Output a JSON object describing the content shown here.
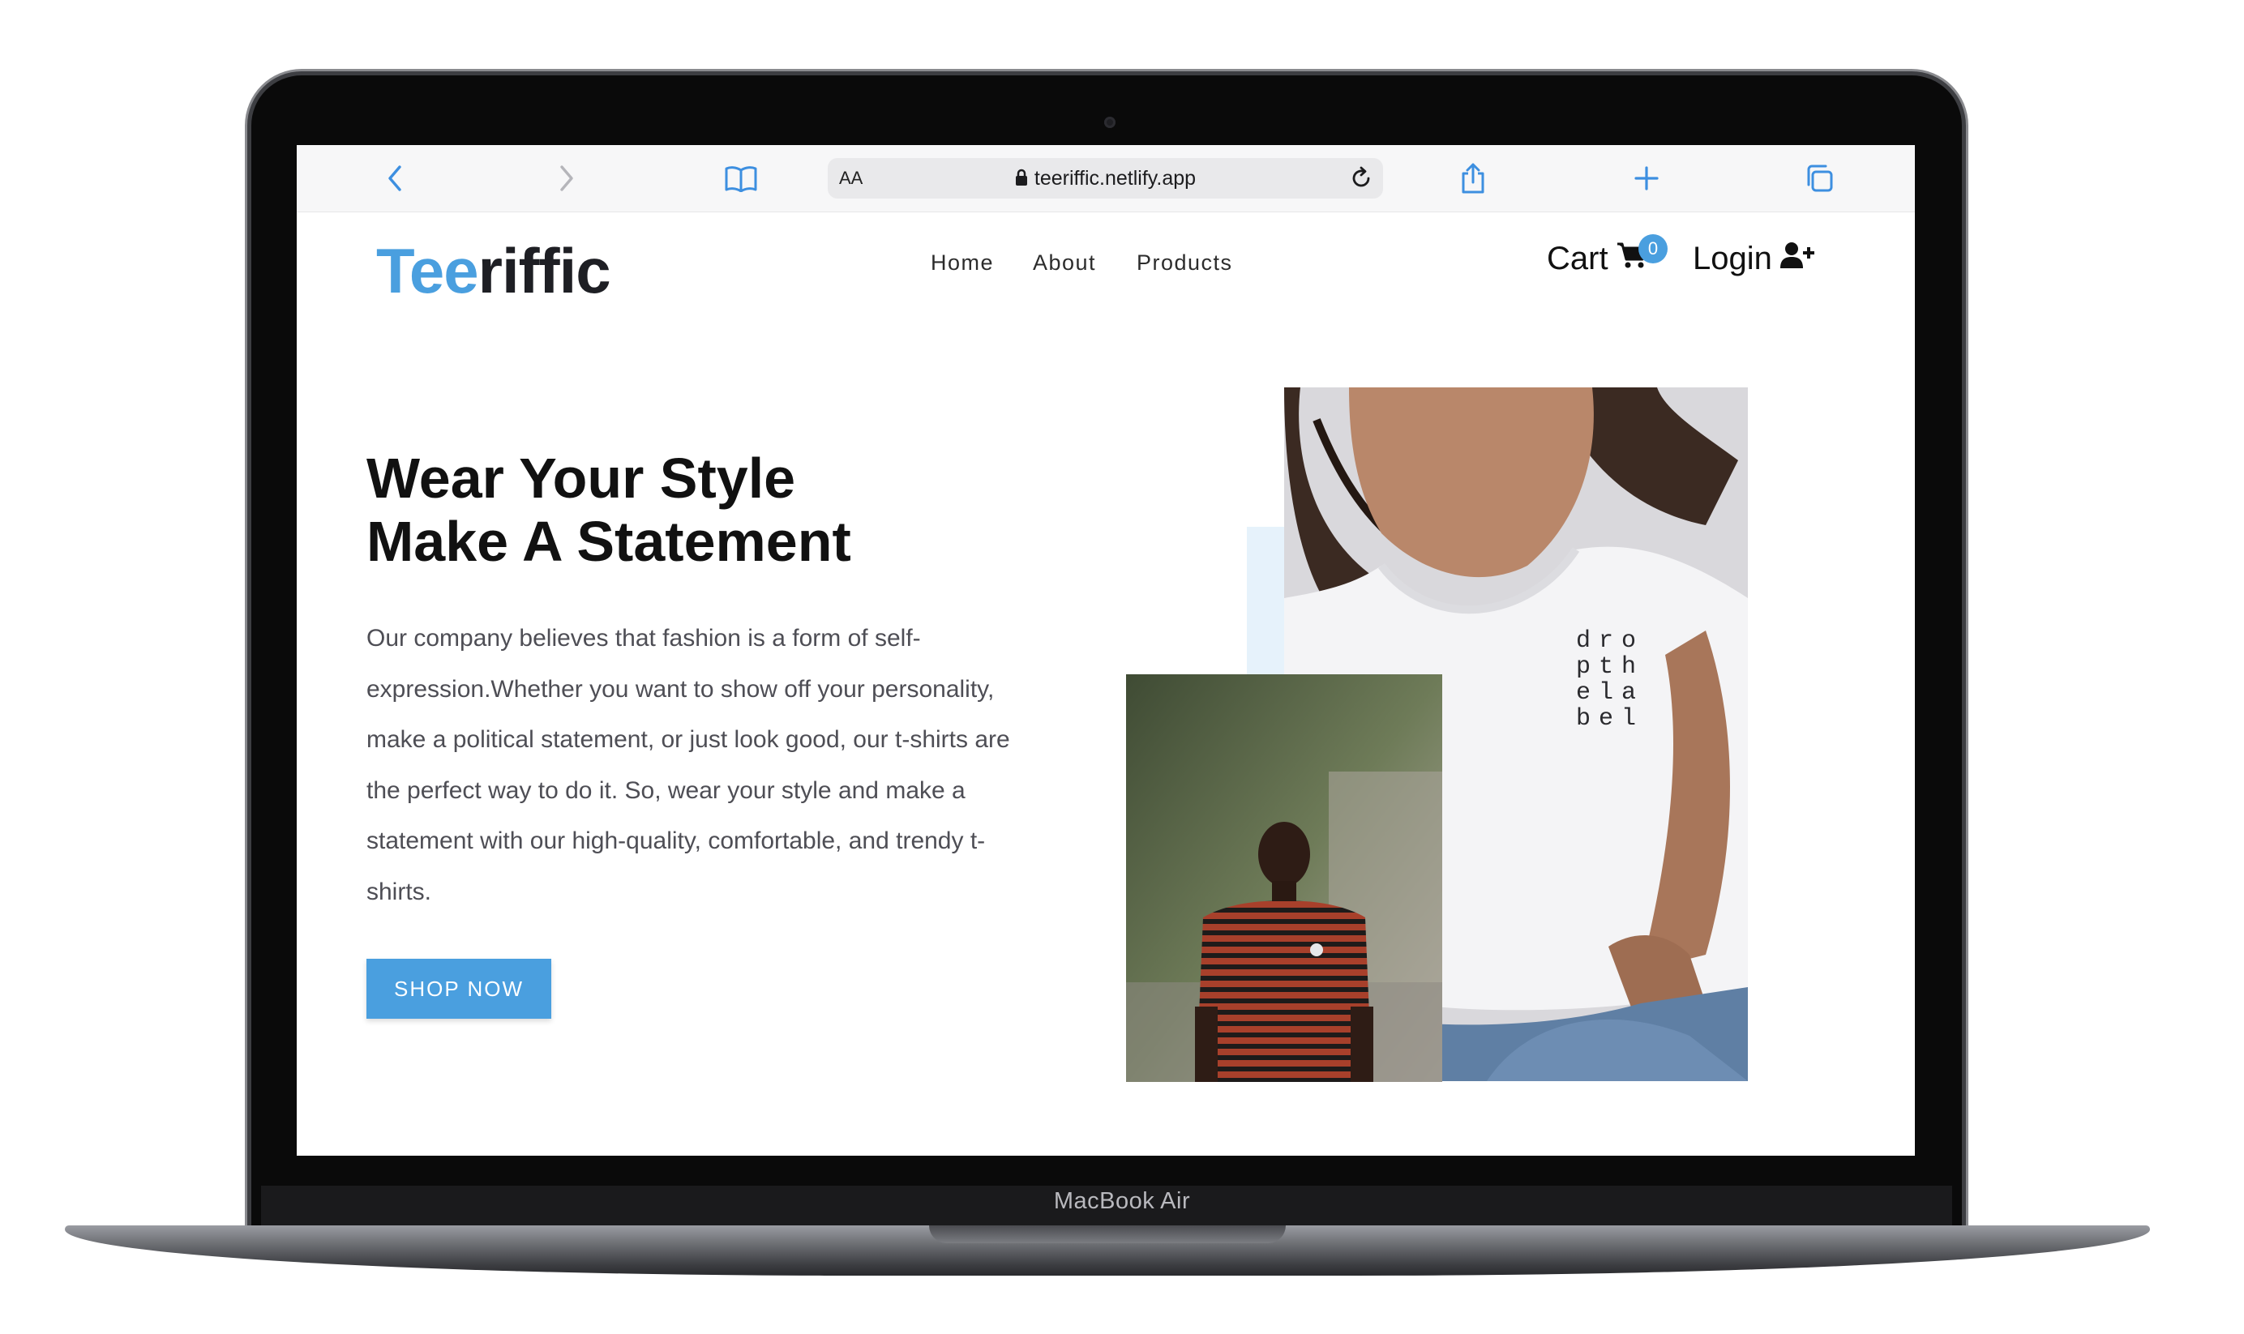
{
  "device": {
    "label": "MacBook Air"
  },
  "browser": {
    "aa_label": "AA",
    "url": "teeriffic.netlify.app"
  },
  "site": {
    "logo_accent": "Tee",
    "logo_rest": "riffic",
    "accent_color": "#4a9fdf",
    "nav": [
      "Home",
      "About",
      "Products"
    ],
    "cart_label": "Cart",
    "cart_count": "0",
    "login_label": "Login"
  },
  "hero": {
    "title_line1": "Wear Your Style",
    "title_line2": "Make A Statement",
    "description": "Our company believes that fashion is a form of self-expression.Whether you want to show off your personality, make a political statement, or just look good, our t-shirts are the perfect way to do it. So, wear your style and make a statement with our high-quality, comfortable, and trendy t-shirts.",
    "cta_label": "SHOP NOW",
    "shirt_print": "dro\npth\nela\nbel"
  }
}
